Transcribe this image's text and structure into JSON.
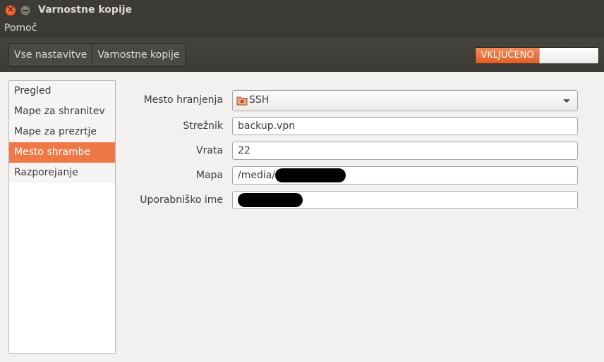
{
  "window": {
    "title": "Varnostne kopije"
  },
  "menubar": {
    "items": [
      {
        "label": "Pomoč"
      }
    ]
  },
  "toolbar": {
    "tabs": [
      {
        "label": "Vse nastavitve"
      },
      {
        "label": "Varnostne kopije"
      }
    ],
    "switch": {
      "label": "VKLJUČENO",
      "state": "on"
    }
  },
  "sidebar": {
    "items": [
      {
        "label": "Pregled"
      },
      {
        "label": "Mape za shranitev"
      },
      {
        "label": "Mape za prezrtje"
      },
      {
        "label": "Mesto shrambe",
        "selected": true
      },
      {
        "label": "Razporejanje"
      }
    ]
  },
  "form": {
    "location": {
      "label": "Mesto hranjenja",
      "value": "SSH",
      "icon": "folder-remote-icon"
    },
    "server": {
      "label": "Strežnik",
      "value": "backup.vpn"
    },
    "port": {
      "label": "Vrata",
      "value": "22"
    },
    "folder": {
      "label": "Mapa",
      "value": "/media/"
    },
    "username": {
      "label": "Uporabniško ime",
      "value": ""
    }
  },
  "colors": {
    "accent": "#f07746",
    "titlebar": "#3c3b37",
    "window_bg": "#f2f1f0"
  }
}
